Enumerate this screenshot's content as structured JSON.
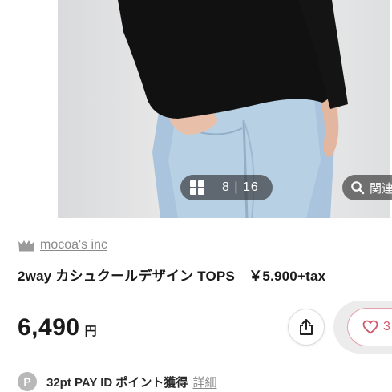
{
  "gallery": {
    "counter_text": "8 | 16",
    "related_label": "関連",
    "icons": [
      "grid-icon",
      "search-icon"
    ]
  },
  "shop": {
    "name": "mocoa's inc",
    "icon": "crown-icon"
  },
  "product": {
    "title": "2way カシュクールデザイン TOPS　￥5.900+tax",
    "price": "6,490",
    "currency_unit": "円"
  },
  "actions": {
    "share_icon": "share-icon",
    "like_icon": "heart-icon",
    "like_count": "3"
  },
  "points": {
    "badge": "P",
    "text": "32pt PAY ID ポイント獲得",
    "detail_link": "詳細"
  },
  "colors": {
    "heart": "#d05a6e",
    "like_border": "#e4a0aa",
    "muted_text": "#8a8a8a",
    "overlay": "#282828"
  }
}
